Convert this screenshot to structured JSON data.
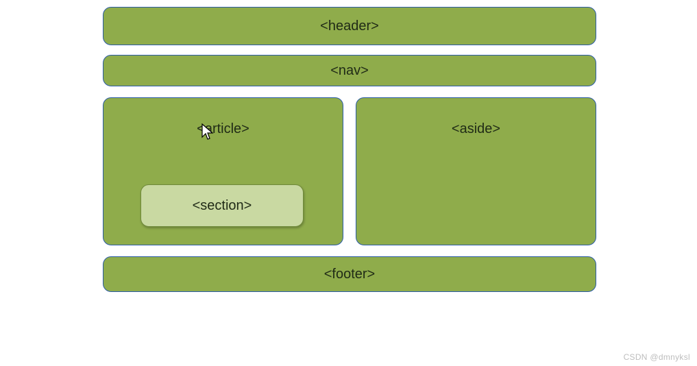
{
  "labels": {
    "header": "<header>",
    "nav": "<nav>",
    "article": "<article>",
    "section": "<section>",
    "aside": "<aside>",
    "footer": "<footer>"
  },
  "watermark": "CSDN @dmnyksl",
  "colors": {
    "box_fill": "#8fac4b",
    "box_border": "#2a5ba8",
    "section_fill": "#c9d9a2",
    "section_border": "#6f8a3a",
    "text": "#1f2a16"
  }
}
